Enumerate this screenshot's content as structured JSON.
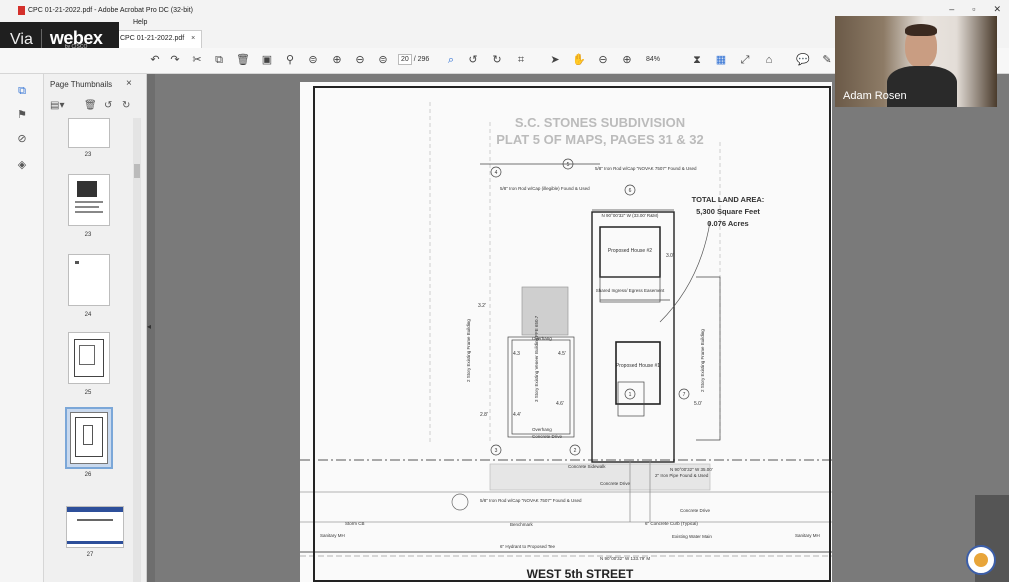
{
  "window": {
    "title": "CPC 01-21-2022.pdf - Adobe Acrobat Pro DC (32-bit)",
    "menu_help": "Help"
  },
  "tab": {
    "label": "CPC 01-21-2022.pdf",
    "close": "×"
  },
  "webex": {
    "via": "Via",
    "brand": "webex",
    "sub": "by CISCO"
  },
  "toolbar": {
    "page_current": "20",
    "page_total": "/ 296",
    "zoom": "84%"
  },
  "thumbnails": {
    "header": "Page Thumbnails",
    "close": "×",
    "pages": [
      {
        "num": "23"
      },
      {
        "num": "23"
      },
      {
        "num": "24"
      },
      {
        "num": "25"
      },
      {
        "num": "26"
      },
      {
        "num": "27"
      }
    ]
  },
  "plan": {
    "title1": "S.C. STONES SUBDIVISION",
    "title2": "PLAT 5 OF MAPS, PAGES 31 & 32",
    "land_area_title": "TOTAL LAND AREA:",
    "land_area_sqft": "5,300 Square Feet",
    "land_area_acres": "0.076 Acres",
    "street": "WEST 5th STREET",
    "house2": "Proposed\nHouse #2",
    "house1": "Proposed\nHouse #1",
    "easement": "Shared Ingress/\nEgress Easement",
    "iron_rod_note": "5/8\" Iron Rod w/Cap \"NOVAK 7507\" Found & Used",
    "iron_rod_left": "5/8\" Iron Rod w/Cap (illegible) Found & Used",
    "iron_rod_bottom": "5/8\" Iron Rod w/Cap \"NOVAK 7507\" Found & Used",
    "pipe_note": "2\" Iron Pipe Found & Used",
    "building_left": "2 Story Existing Frame Building",
    "building_mid": "3 Story Existing Veneer Building FFE 650.7",
    "building_right": "2 Story Existing Frame Building",
    "overhang": "Overhang",
    "overhang2": "Overhang",
    "concrete_drive": "Concrete Drive",
    "concrete_sidewalk": "Concrete Sidewalk",
    "concrete_drive2": "Concrete Drive",
    "concrete_drive3": "Concrete Drive",
    "curb": "6\" Concrete Curb (Typical)",
    "benchmark": "Benchmark",
    "storm": "Storm CB",
    "sanitary_left": "Sanitary MH",
    "sanitary_right": "Sanitary MH",
    "water": "Existing Water Main",
    "hydrant": "6\" Hydrant to Proposed Tee",
    "dim_top": "N 90°00'32\" W (33.00' R&M)",
    "dim_mid": "N 90°00'32\" W 35.00'",
    "dim_bot": "N 90°00'32\" W 133.79' M",
    "circles": [
      "4",
      "5",
      "6",
      "7",
      "3",
      "1",
      "2"
    ],
    "setbacks": [
      "3.0'",
      "3.2'",
      "4.3",
      "4.5'",
      "2.8'",
      "4.4'",
      "4.6'",
      "5.0'"
    ]
  },
  "camera": {
    "name": "Adam Rosen"
  },
  "colors": {
    "accent": "#2d6fd4",
    "webex_bg": "#1f1f1f",
    "page": "#fafafa"
  }
}
